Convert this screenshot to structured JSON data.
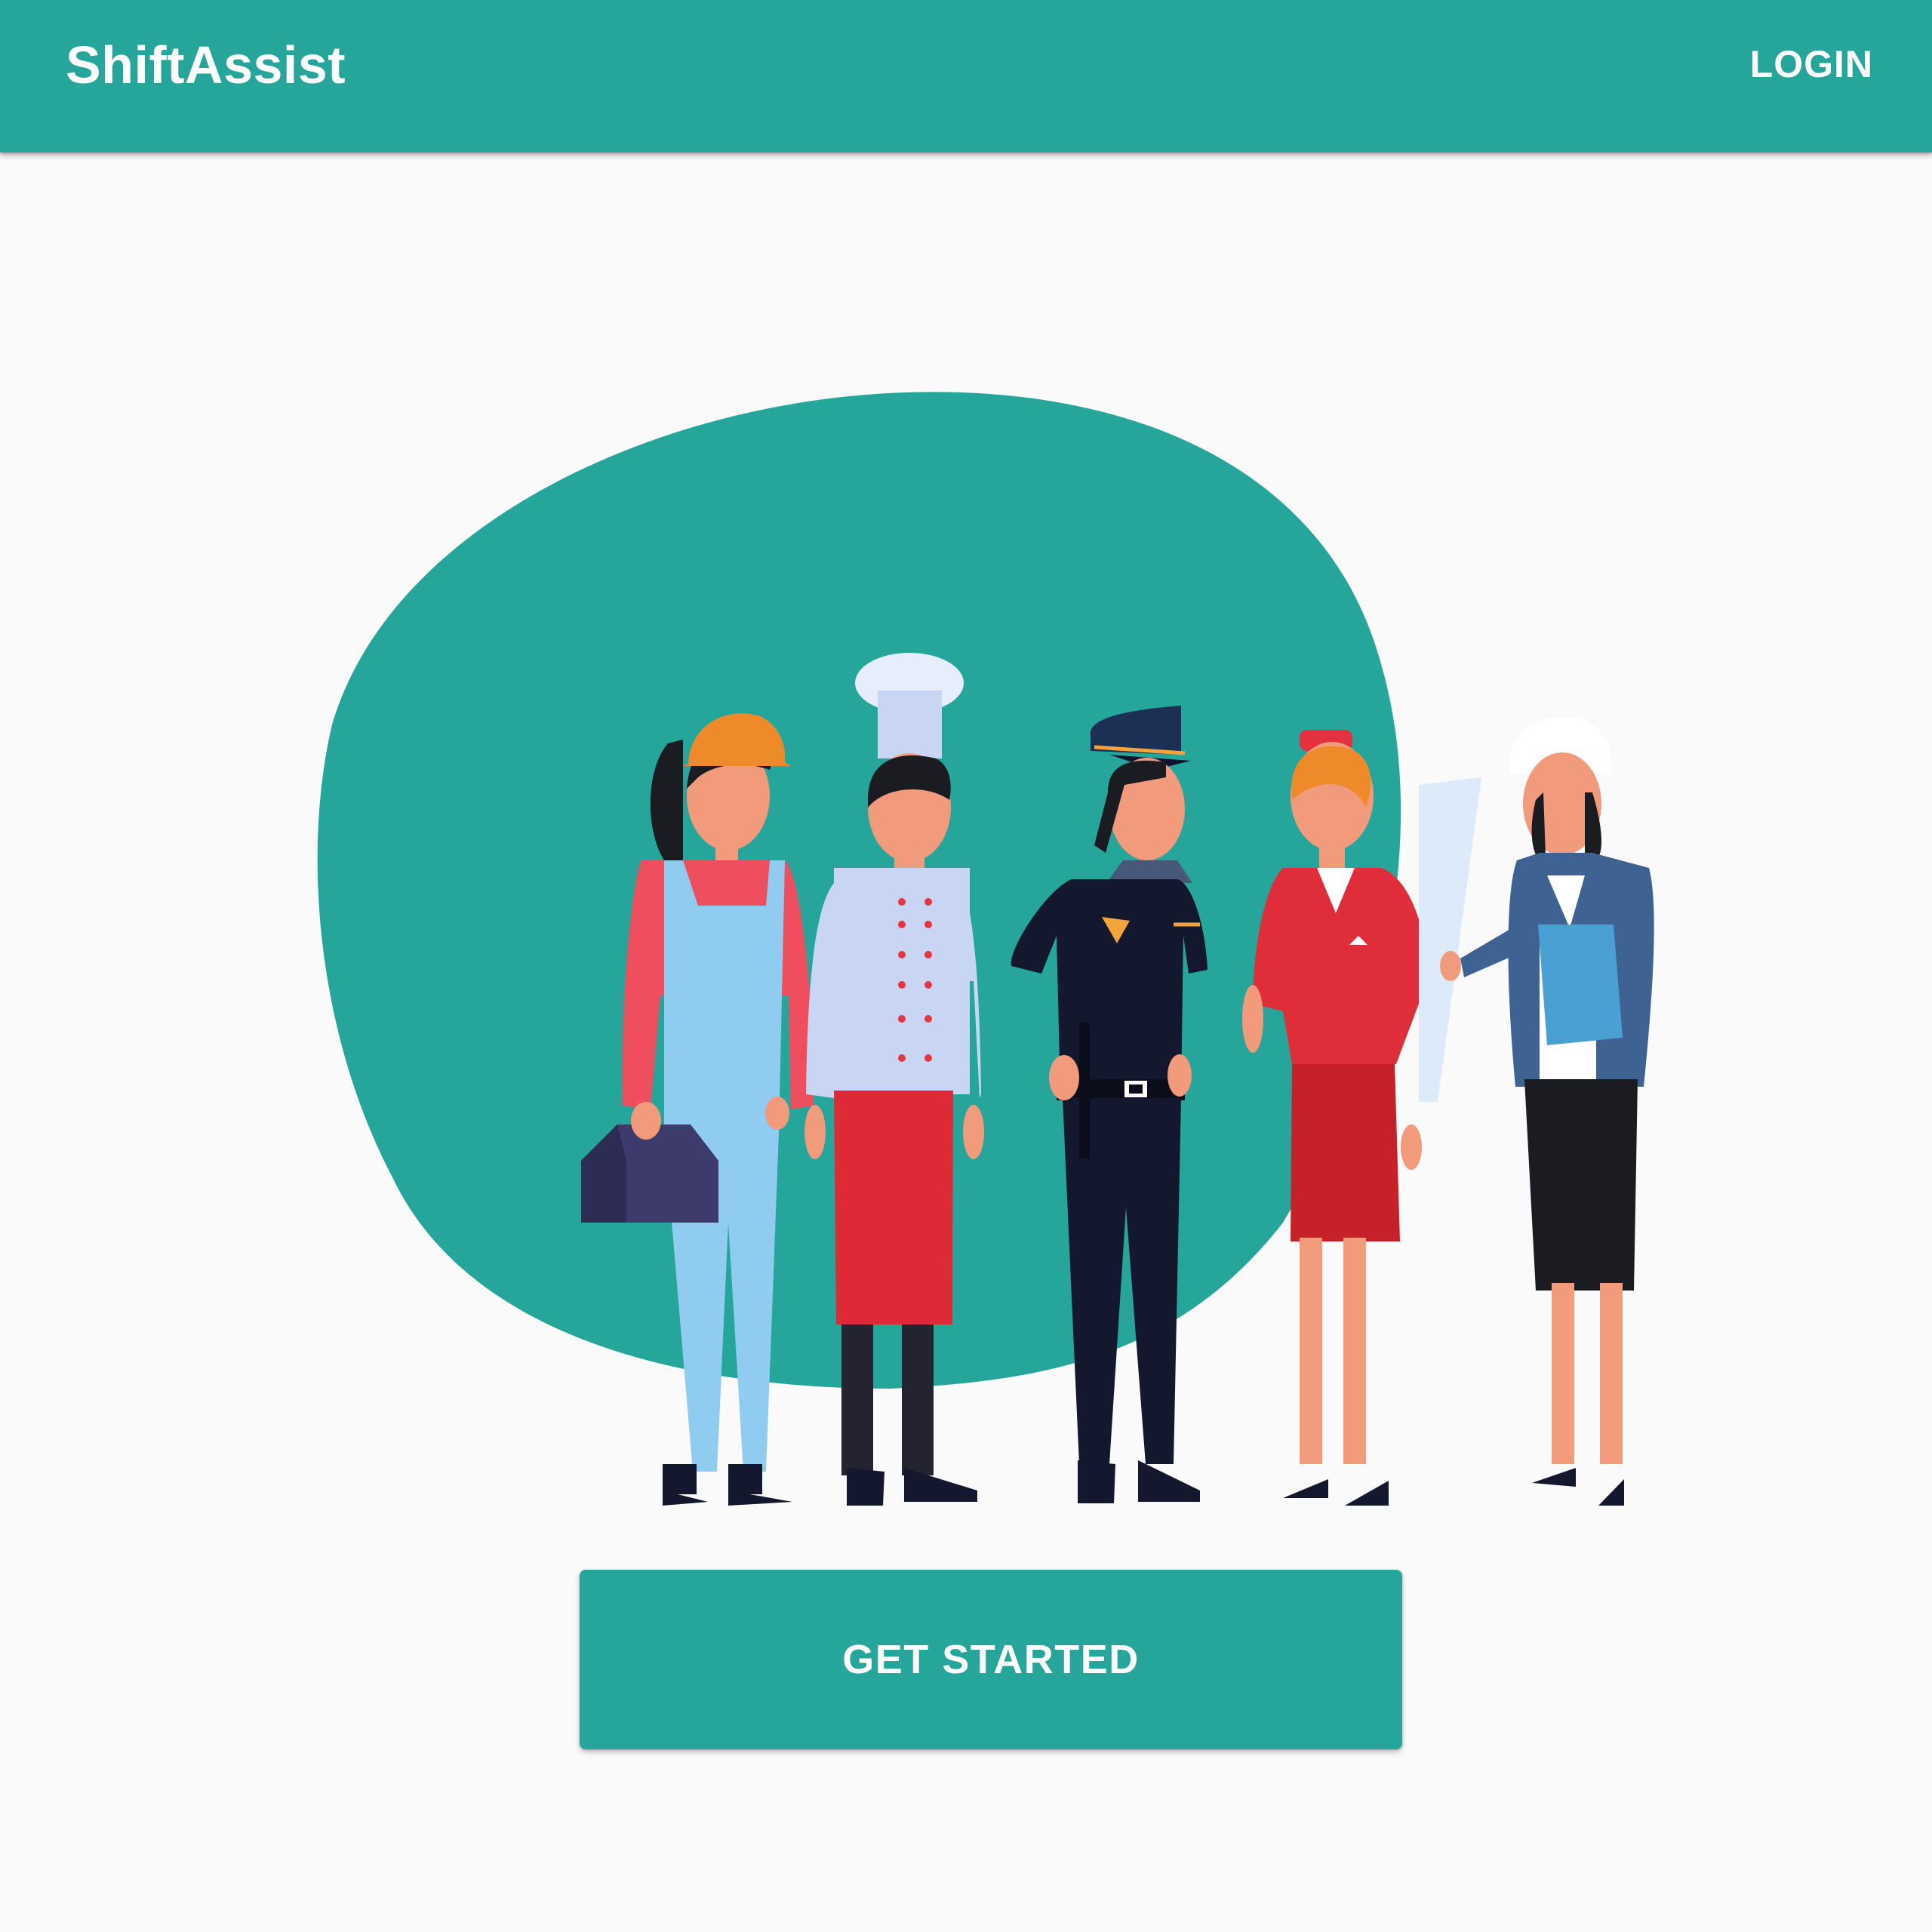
{
  "app_bar": {
    "title": "ShiftAssist",
    "login_label": "LOGIN"
  },
  "hero": {
    "illustration": "group-of-workers-illustration",
    "figures": [
      "construction-worker",
      "chef",
      "police-officer",
      "flight-attendant",
      "architect"
    ]
  },
  "cta": {
    "label": "GET STARTED"
  },
  "colors": {
    "primary": "#26a69a",
    "background": "#fafafa",
    "on_primary": "#ffffff"
  }
}
